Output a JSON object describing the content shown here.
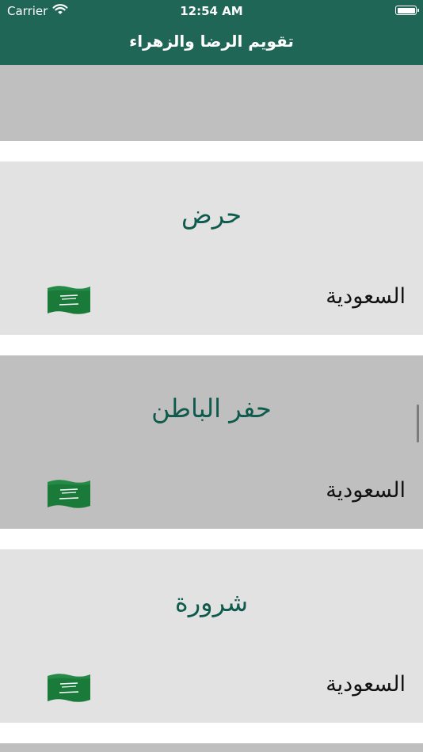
{
  "status_bar": {
    "carrier": "Carrier",
    "time": "12:54 AM",
    "wifi_icon": "wifi-icon",
    "battery_icon": "battery-icon"
  },
  "header": {
    "title": "تقويم الرضا والزهراء",
    "background_color": "#1f6657"
  },
  "cards": [
    {
      "city": "حرض",
      "country": "السعودية",
      "flag_icon": "saudi-flag-icon",
      "background_color": "#e2e2e2"
    },
    {
      "city": "حفر الباطن",
      "country": "السعودية",
      "flag_icon": "saudi-flag-icon",
      "background_color": "#bfbfbf"
    },
    {
      "city": "شرورة",
      "country": "السعودية",
      "flag_icon": "saudi-flag-icon",
      "background_color": "#e2e2e2"
    }
  ],
  "colors": {
    "city_text": "#0e5a4c",
    "flag_green": "#1a7a3a"
  }
}
